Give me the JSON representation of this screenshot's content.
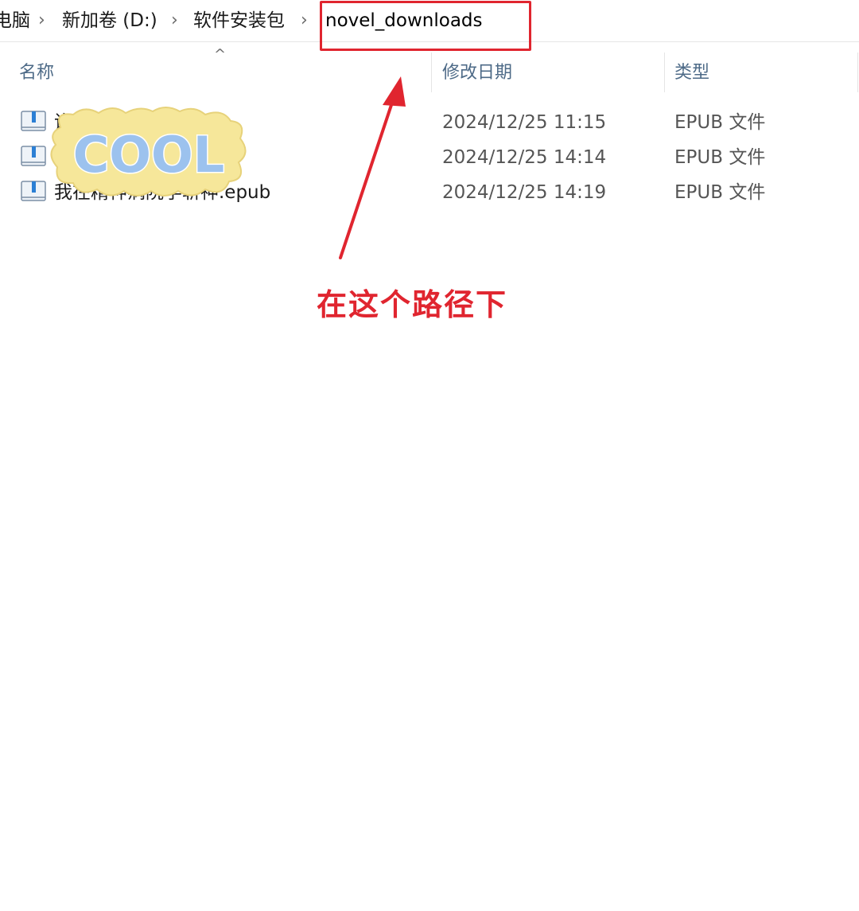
{
  "breadcrumb": {
    "items": [
      "电脑",
      "新加卷 (D:)",
      "软件安装包",
      "novel_downloads"
    ],
    "separator": "›"
  },
  "columns": {
    "name": "名称",
    "date": "修改日期",
    "type": "类型",
    "sort_indicator": "^"
  },
  "files": [
    {
      "name": "诡",
      "modified": "2024/12/25 11:15",
      "type": "EPUB 文件",
      "icon": "epub-file-icon"
    },
    {
      "name": "",
      "modified": "2024/12/25 14:14",
      "type": "EPUB 文件",
      "icon": "epub-file-icon"
    },
    {
      "name": "我在精神病院学斩神.epub",
      "modified": "2024/12/25 14:19",
      "type": "EPUB 文件",
      "icon": "epub-file-icon"
    }
  ],
  "sticker": {
    "text": "COOL"
  },
  "annotation": {
    "text": "在这个路径下",
    "color": "#e0252f"
  }
}
